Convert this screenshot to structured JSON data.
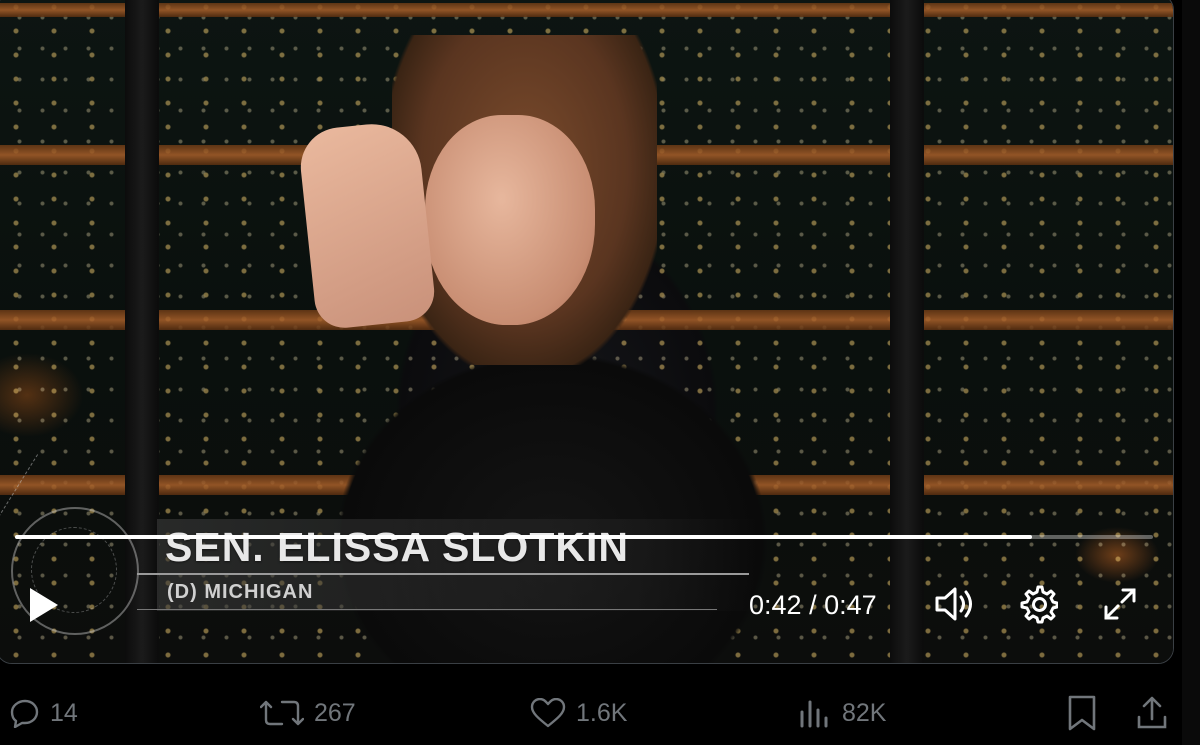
{
  "video": {
    "lower_third": {
      "name": "SEN. ELISSA SLOTKIN",
      "subtitle": "(D) MICHIGAN"
    },
    "player": {
      "current_time": "0:42",
      "separator": "/",
      "duration": "0:47",
      "progress_fraction": 0.894,
      "play_icon": "play-icon",
      "volume_icon": "volume-icon",
      "settings_icon": "gear-icon",
      "fullscreen_icon": "expand-icon"
    }
  },
  "actions": {
    "replies": {
      "icon": "reply-icon",
      "count": "14"
    },
    "reposts": {
      "icon": "repost-icon",
      "count": "267"
    },
    "likes": {
      "icon": "heart-icon",
      "count": "1.6K"
    },
    "views": {
      "icon": "views-icon",
      "count": "82K"
    },
    "bookmark": {
      "icon": "bookmark-icon"
    },
    "share": {
      "icon": "share-icon"
    }
  },
  "colors": {
    "background": "#000000",
    "muted_text": "#71767b",
    "frame_border": "#3a3f44"
  }
}
